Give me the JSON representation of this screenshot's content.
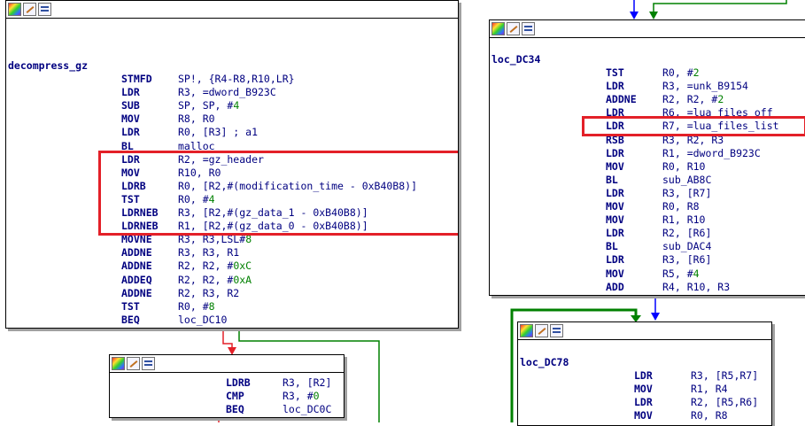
{
  "blocks": {
    "decompress_gz": {
      "label": "decompress_gz",
      "rows": [
        {
          "m": "STMFD",
          "o": "SP!, {R4-R8,R10,LR}"
        },
        {
          "m": "LDR",
          "o": "R3, =dword_B923C"
        },
        {
          "m": "SUB",
          "o": "SP, SP, #4"
        },
        {
          "m": "MOV",
          "o": "R8, R0"
        },
        {
          "m": "LDR",
          "o": "R0, [R3] ; a1"
        },
        {
          "m": "BL",
          "o": "malloc"
        },
        {
          "m": "LDR",
          "o": "R2, =gz_header"
        },
        {
          "m": "MOV",
          "o": "R10, R0"
        },
        {
          "m": "LDRB",
          "o": "R0, [R2,#(modification_time - 0xB40B8)]"
        },
        {
          "m": "TST",
          "o": "R0, #4"
        },
        {
          "m": "LDRNEB",
          "o": "R3, [R2,#(gz_data_1 - 0xB40B8)]"
        },
        {
          "m": "LDRNEB",
          "o": "R1, [R2,#(gz_data_0 - 0xB40B8)]"
        },
        {
          "m": "MOVNE",
          "o": "R3, R3,LSL#8"
        },
        {
          "m": "ADDNE",
          "o": "R3, R3, R1"
        },
        {
          "m": "ADDNE",
          "o": "R2, R2, #0xC"
        },
        {
          "m": "ADDEQ",
          "o": "R2, R2, #0xA"
        },
        {
          "m": "ADDNE",
          "o": "R2, R3, R2"
        },
        {
          "m": "TST",
          "o": "R0, #8"
        },
        {
          "m": "BEQ",
          "o": "loc_DC10"
        }
      ]
    },
    "loc_DC34": {
      "label": "loc_DC34",
      "rows": [
        {
          "m": "TST",
          "o": "R0, #2"
        },
        {
          "m": "LDR",
          "o": "R3, =unk_B9154"
        },
        {
          "m": "ADDNE",
          "o": "R2, R2, #2"
        },
        {
          "m": "LDR",
          "o": "R6, =lua_files_off"
        },
        {
          "m": "LDR",
          "o": "R7, =lua_files_list"
        },
        {
          "m": "RSB",
          "o": "R3, R2, R3"
        },
        {
          "m": "LDR",
          "o": "R1, =dword_B923C"
        },
        {
          "m": "MOV",
          "o": "R0, R10"
        },
        {
          "m": "BL",
          "o": "sub_AB8C"
        },
        {
          "m": "LDR",
          "o": "R3, [R7]"
        },
        {
          "m": "MOV",
          "o": "R0, R8"
        },
        {
          "m": "MOV",
          "o": "R1, R10"
        },
        {
          "m": "LDR",
          "o": "R2, [R6]"
        },
        {
          "m": "BL",
          "o": "sub_DAC4"
        },
        {
          "m": "LDR",
          "o": "R3, [R6]"
        },
        {
          "m": "MOV",
          "o": "R5, #4"
        },
        {
          "m": "ADD",
          "o": "R4, R10, R3"
        }
      ]
    },
    "loc_DC78": {
      "label": "loc_DC78",
      "rows": [
        {
          "m": "LDR",
          "o": "R3, [R5,R7]"
        },
        {
          "m": "MOV",
          "o": "R1, R4"
        },
        {
          "m": "LDR",
          "o": "R2, [R5,R6]"
        },
        {
          "m": "MOV",
          "o": "R0, R8"
        }
      ]
    },
    "small": {
      "rows": [
        {
          "m": "LDRB",
          "o": "R3, [R2]"
        },
        {
          "m": "CMP",
          "o": "R3, #0"
        },
        {
          "m": "BEQ",
          "o": "loc_DC0C"
        }
      ]
    }
  },
  "colors": {
    "highlight": "#e32028",
    "edge_true": "#008000",
    "edge_false": "#e32028",
    "edge_flow": "#0000ff",
    "shadow": "#a0a0a0"
  },
  "icons": [
    "color-palette-icon",
    "rename-icon",
    "graph-overview-icon"
  ]
}
